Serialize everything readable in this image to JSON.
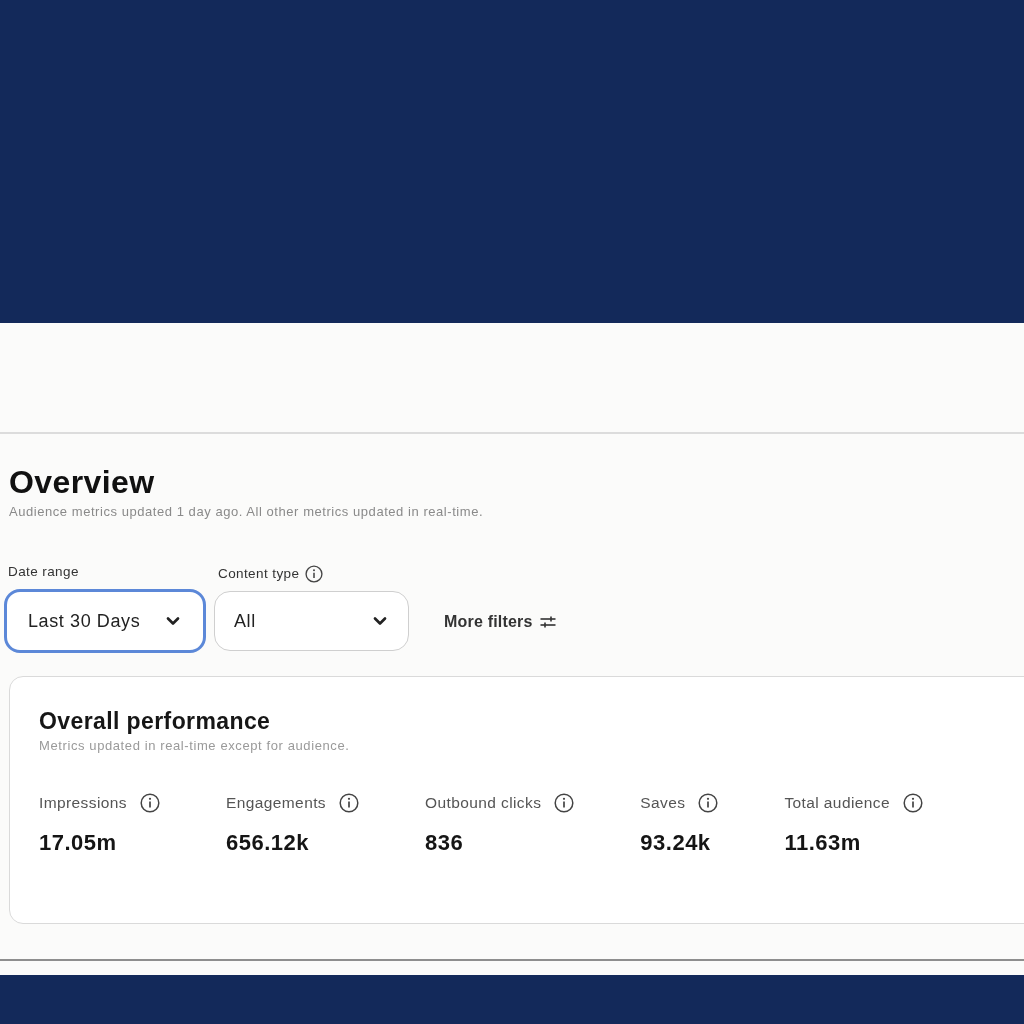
{
  "page": {
    "title": "Overview",
    "subtitle": "Audience metrics updated 1 day ago. All other metrics updated in real-time."
  },
  "filters": [
    {
      "label": "Date range",
      "info": false,
      "value": "Last 30 Days",
      "focused": true
    },
    {
      "label": "Content type",
      "info": true,
      "value": "All",
      "focused": false
    }
  ],
  "more_filters": {
    "label": "More filters"
  },
  "performance": {
    "title": "Overall performance",
    "subtitle": "Metrics updated in real-time except for audience.",
    "metrics": [
      {
        "label": "Impressions",
        "value": "17.05m"
      },
      {
        "label": "Engagements",
        "value": "656.12k"
      },
      {
        "label": "Outbound clicks",
        "value": "836"
      },
      {
        "label": "Saves",
        "value": "93.24k"
      },
      {
        "label": "Total audience",
        "value": "11.63m"
      }
    ]
  }
}
